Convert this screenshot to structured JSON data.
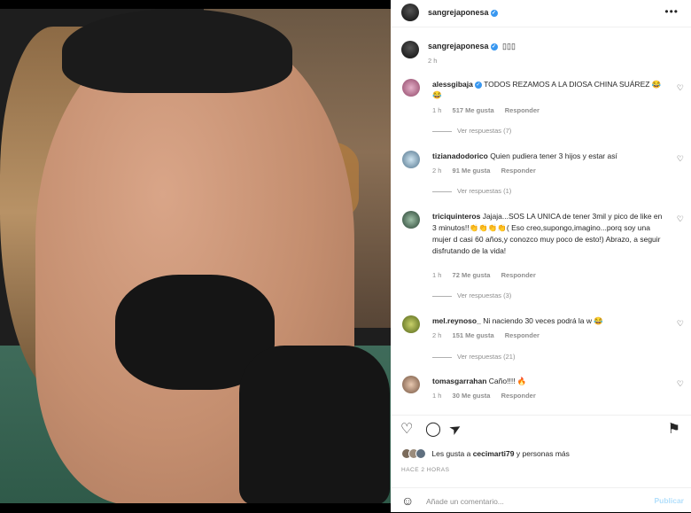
{
  "post_author": {
    "username": "sangrejaponesa",
    "verified": true
  },
  "caption": {
    "username": "sangrejaponesa",
    "text": "▯▯▯",
    "time": "2 h"
  },
  "comments": [
    {
      "username": "alessgibaja",
      "verified": true,
      "text": "TODOS REZAMOS A LA DIOSA CHINA SUÁREZ 😂😂",
      "time": "1 h",
      "likes": "517 Me gusta",
      "reply": "Responder",
      "replies": "Ver respuestas (7)"
    },
    {
      "username": "tizianadodorico",
      "verified": false,
      "text": "Quien pudiera tener 3 hijos y estar así",
      "time": "2 h",
      "likes": "91 Me gusta",
      "reply": "Responder",
      "replies": "Ver respuestas (1)"
    },
    {
      "username": "triciquinteros",
      "verified": false,
      "text": "Jajaja...SOS LA UNICA de tener 3mil y pico de like en 3 minutos!!👏👏👏👏( Eso creo,supongo,imagino...porq soy una mujer d casi 60 años,y conozco muy poco de esto!) Abrazo, a seguir disfrutando de la vida!",
      "time": "1 h",
      "likes": "72 Me gusta",
      "reply": "Responder",
      "replies": "Ver respuestas (3)"
    },
    {
      "username": "mel.reynoso_",
      "verified": false,
      "text": "Ni naciendo 30 veces podrá la w 😂",
      "time": "2 h",
      "likes": "151 Me gusta",
      "reply": "Responder",
      "replies": "Ver respuestas (21)"
    },
    {
      "username": "tomasgarrahan",
      "verified": false,
      "text": "Caño!!!! 🔥",
      "time": "1 h",
      "likes": "30 Me gusta",
      "reply": "Responder",
      "replies": ""
    }
  ],
  "likes_summary": {
    "prefix": "Les gusta a",
    "user": "cecimarti79",
    "suffix": "y personas más"
  },
  "time_ago": "HACE 2 HORAS",
  "comment_box": {
    "placeholder": "Añade un comentario...",
    "publish": "Publicar"
  },
  "icons": {
    "heart": "♡",
    "comment": "◯",
    "share": "➤",
    "bookmark": "⚑",
    "more": "•••",
    "emoji": "☺"
  },
  "colors": {
    "verified": "#3897f0",
    "publish": "#b2dffc"
  }
}
